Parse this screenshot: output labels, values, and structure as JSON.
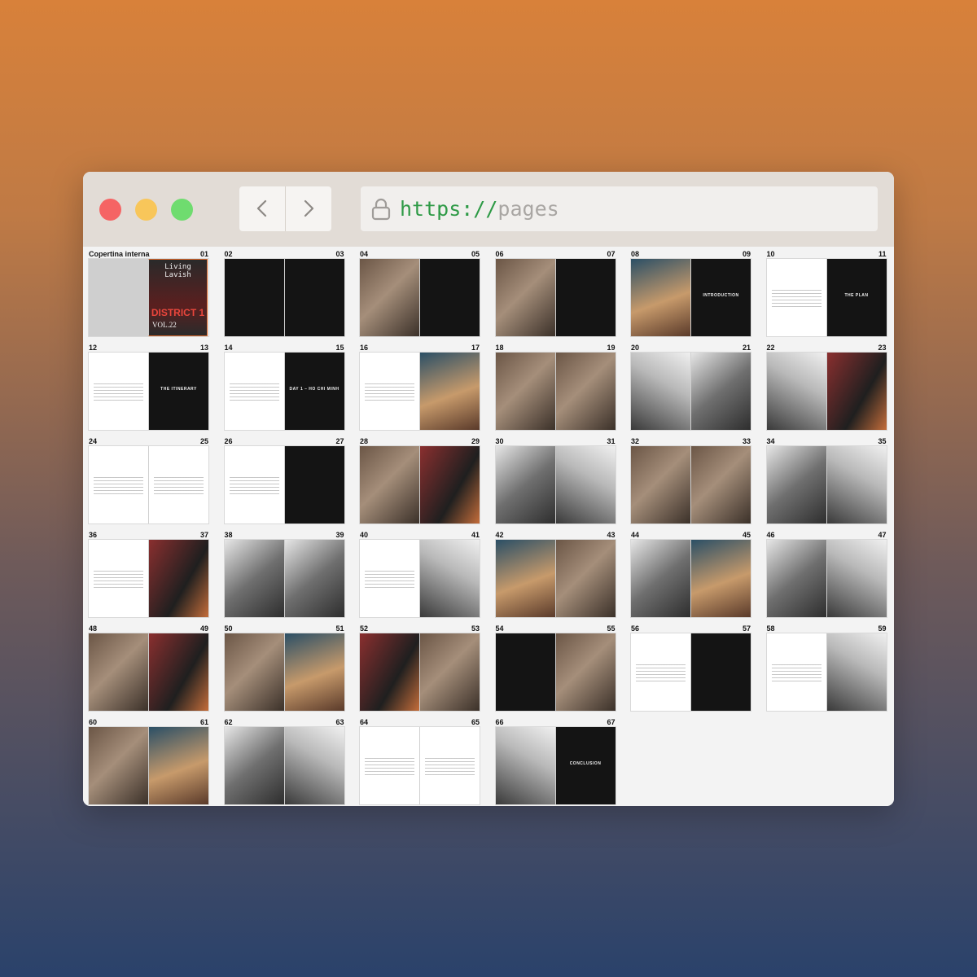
{
  "browser": {
    "url_scheme": "https://",
    "url_path": "pages"
  },
  "icons": {
    "back": "chevron-left-icon",
    "forward": "chevron-right-icon",
    "lock": "lock-icon"
  },
  "colors": {
    "close": "#f56464",
    "minimize": "#f8c65a",
    "maximize": "#6fdc6f",
    "url_scheme": "#2e9a46",
    "cover_border": "#d6662b"
  },
  "spreads": [
    {
      "left": "Copertina interna",
      "right": "01",
      "tones": [
        "grey",
        "cover"
      ],
      "cover": {
        "title": "Living Lavish",
        "district": "DISTRICT 1",
        "vol": "VOL.22"
      }
    },
    {
      "left": "02",
      "right": "03",
      "tones": [
        "black",
        "black"
      ]
    },
    {
      "left": "04",
      "right": "05",
      "tones": [
        "photo",
        "black"
      ]
    },
    {
      "left": "06",
      "right": "07",
      "tones": [
        "photo",
        "black"
      ]
    },
    {
      "left": "08",
      "right": "09",
      "tones": [
        "photo2",
        "black"
      ],
      "label_right": "INTRODUCTION"
    },
    {
      "left": "10",
      "right": "11",
      "tones": [
        "white",
        "black"
      ],
      "label_right": "THE PLAN"
    },
    {
      "left": "12",
      "right": "13",
      "tones": [
        "white",
        "black"
      ],
      "label_right": "THE ITINERARY"
    },
    {
      "left": "14",
      "right": "15",
      "tones": [
        "white",
        "black"
      ],
      "label_right": "DAY 1 – HO CHI MINH"
    },
    {
      "left": "16",
      "right": "17",
      "tones": [
        "white",
        "photo2"
      ]
    },
    {
      "left": "18",
      "right": "19",
      "tones": [
        "photo",
        "photo"
      ]
    },
    {
      "left": "20",
      "right": "21",
      "tones": [
        "bw2",
        "bw"
      ]
    },
    {
      "left": "22",
      "right": "23",
      "tones": [
        "bw2",
        "photo3"
      ]
    },
    {
      "left": "24",
      "right": "25",
      "tones": [
        "white",
        "white"
      ]
    },
    {
      "left": "26",
      "right": "27",
      "tones": [
        "white",
        "black"
      ]
    },
    {
      "left": "28",
      "right": "29",
      "tones": [
        "photo",
        "photo3"
      ]
    },
    {
      "left": "30",
      "right": "31",
      "tones": [
        "bw",
        "bw2"
      ]
    },
    {
      "left": "32",
      "right": "33",
      "tones": [
        "photo",
        "photo"
      ]
    },
    {
      "left": "34",
      "right": "35",
      "tones": [
        "bw",
        "bw2"
      ]
    },
    {
      "left": "36",
      "right": "37",
      "tones": [
        "white",
        "photo3"
      ]
    },
    {
      "left": "38",
      "right": "39",
      "tones": [
        "bw",
        "bw"
      ]
    },
    {
      "left": "40",
      "right": "41",
      "tones": [
        "white",
        "bw2"
      ]
    },
    {
      "left": "42",
      "right": "43",
      "tones": [
        "photo2",
        "photo"
      ]
    },
    {
      "left": "44",
      "right": "45",
      "tones": [
        "bw",
        "photo2"
      ]
    },
    {
      "left": "46",
      "right": "47",
      "tones": [
        "bw",
        "bw2"
      ]
    },
    {
      "left": "48",
      "right": "49",
      "tones": [
        "photo",
        "photo3"
      ]
    },
    {
      "left": "50",
      "right": "51",
      "tones": [
        "photo",
        "photo2"
      ]
    },
    {
      "left": "52",
      "right": "53",
      "tones": [
        "photo3",
        "photo"
      ]
    },
    {
      "left": "54",
      "right": "55",
      "tones": [
        "black",
        "photo"
      ]
    },
    {
      "left": "56",
      "right": "57",
      "tones": [
        "white",
        "black"
      ]
    },
    {
      "left": "58",
      "right": "59",
      "tones": [
        "white",
        "bw2"
      ]
    },
    {
      "left": "60",
      "right": "61",
      "tones": [
        "photo",
        "photo2"
      ]
    },
    {
      "left": "62",
      "right": "63",
      "tones": [
        "bw",
        "bw2"
      ]
    },
    {
      "left": "64",
      "right": "65",
      "tones": [
        "white",
        "white"
      ]
    },
    {
      "left": "66",
      "right": "67",
      "tones": [
        "bw2",
        "black"
      ],
      "label_right": "CONCLUSION"
    }
  ]
}
